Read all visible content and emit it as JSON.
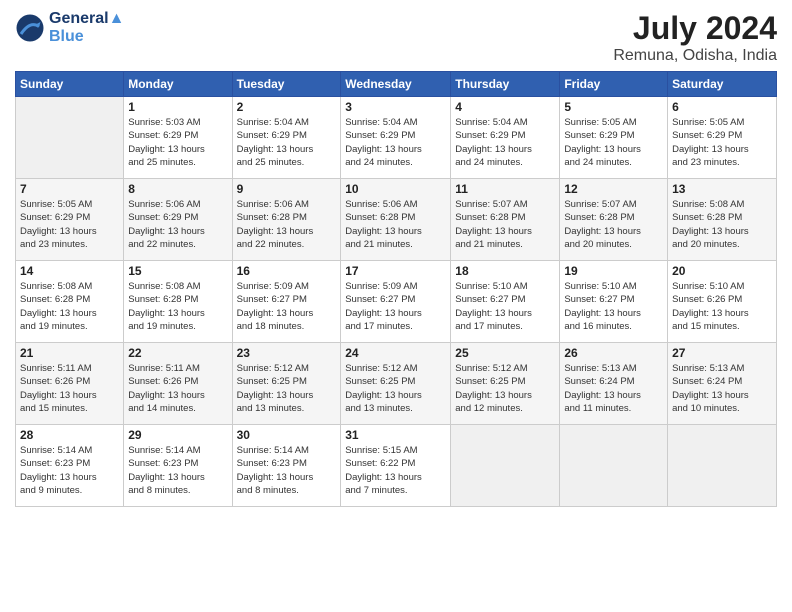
{
  "header": {
    "logo_line1": "General",
    "logo_line2": "Blue",
    "title": "July 2024",
    "location": "Remuna, Odisha, India"
  },
  "weekdays": [
    "Sunday",
    "Monday",
    "Tuesday",
    "Wednesday",
    "Thursday",
    "Friday",
    "Saturday"
  ],
  "weeks": [
    [
      {
        "day": "",
        "info": ""
      },
      {
        "day": "1",
        "info": "Sunrise: 5:03 AM\nSunset: 6:29 PM\nDaylight: 13 hours\nand 25 minutes."
      },
      {
        "day": "2",
        "info": "Sunrise: 5:04 AM\nSunset: 6:29 PM\nDaylight: 13 hours\nand 25 minutes."
      },
      {
        "day": "3",
        "info": "Sunrise: 5:04 AM\nSunset: 6:29 PM\nDaylight: 13 hours\nand 24 minutes."
      },
      {
        "day": "4",
        "info": "Sunrise: 5:04 AM\nSunset: 6:29 PM\nDaylight: 13 hours\nand 24 minutes."
      },
      {
        "day": "5",
        "info": "Sunrise: 5:05 AM\nSunset: 6:29 PM\nDaylight: 13 hours\nand 24 minutes."
      },
      {
        "day": "6",
        "info": "Sunrise: 5:05 AM\nSunset: 6:29 PM\nDaylight: 13 hours\nand 23 minutes."
      }
    ],
    [
      {
        "day": "7",
        "info": "Sunrise: 5:05 AM\nSunset: 6:29 PM\nDaylight: 13 hours\nand 23 minutes."
      },
      {
        "day": "8",
        "info": "Sunrise: 5:06 AM\nSunset: 6:29 PM\nDaylight: 13 hours\nand 22 minutes."
      },
      {
        "day": "9",
        "info": "Sunrise: 5:06 AM\nSunset: 6:28 PM\nDaylight: 13 hours\nand 22 minutes."
      },
      {
        "day": "10",
        "info": "Sunrise: 5:06 AM\nSunset: 6:28 PM\nDaylight: 13 hours\nand 21 minutes."
      },
      {
        "day": "11",
        "info": "Sunrise: 5:07 AM\nSunset: 6:28 PM\nDaylight: 13 hours\nand 21 minutes."
      },
      {
        "day": "12",
        "info": "Sunrise: 5:07 AM\nSunset: 6:28 PM\nDaylight: 13 hours\nand 20 minutes."
      },
      {
        "day": "13",
        "info": "Sunrise: 5:08 AM\nSunset: 6:28 PM\nDaylight: 13 hours\nand 20 minutes."
      }
    ],
    [
      {
        "day": "14",
        "info": "Sunrise: 5:08 AM\nSunset: 6:28 PM\nDaylight: 13 hours\nand 19 minutes."
      },
      {
        "day": "15",
        "info": "Sunrise: 5:08 AM\nSunset: 6:28 PM\nDaylight: 13 hours\nand 19 minutes."
      },
      {
        "day": "16",
        "info": "Sunrise: 5:09 AM\nSunset: 6:27 PM\nDaylight: 13 hours\nand 18 minutes."
      },
      {
        "day": "17",
        "info": "Sunrise: 5:09 AM\nSunset: 6:27 PM\nDaylight: 13 hours\nand 17 minutes."
      },
      {
        "day": "18",
        "info": "Sunrise: 5:10 AM\nSunset: 6:27 PM\nDaylight: 13 hours\nand 17 minutes."
      },
      {
        "day": "19",
        "info": "Sunrise: 5:10 AM\nSunset: 6:27 PM\nDaylight: 13 hours\nand 16 minutes."
      },
      {
        "day": "20",
        "info": "Sunrise: 5:10 AM\nSunset: 6:26 PM\nDaylight: 13 hours\nand 15 minutes."
      }
    ],
    [
      {
        "day": "21",
        "info": "Sunrise: 5:11 AM\nSunset: 6:26 PM\nDaylight: 13 hours\nand 15 minutes."
      },
      {
        "day": "22",
        "info": "Sunrise: 5:11 AM\nSunset: 6:26 PM\nDaylight: 13 hours\nand 14 minutes."
      },
      {
        "day": "23",
        "info": "Sunrise: 5:12 AM\nSunset: 6:25 PM\nDaylight: 13 hours\nand 13 minutes."
      },
      {
        "day": "24",
        "info": "Sunrise: 5:12 AM\nSunset: 6:25 PM\nDaylight: 13 hours\nand 13 minutes."
      },
      {
        "day": "25",
        "info": "Sunrise: 5:12 AM\nSunset: 6:25 PM\nDaylight: 13 hours\nand 12 minutes."
      },
      {
        "day": "26",
        "info": "Sunrise: 5:13 AM\nSunset: 6:24 PM\nDaylight: 13 hours\nand 11 minutes."
      },
      {
        "day": "27",
        "info": "Sunrise: 5:13 AM\nSunset: 6:24 PM\nDaylight: 13 hours\nand 10 minutes."
      }
    ],
    [
      {
        "day": "28",
        "info": "Sunrise: 5:14 AM\nSunset: 6:23 PM\nDaylight: 13 hours\nand 9 minutes."
      },
      {
        "day": "29",
        "info": "Sunrise: 5:14 AM\nSunset: 6:23 PM\nDaylight: 13 hours\nand 8 minutes."
      },
      {
        "day": "30",
        "info": "Sunrise: 5:14 AM\nSunset: 6:23 PM\nDaylight: 13 hours\nand 8 minutes."
      },
      {
        "day": "31",
        "info": "Sunrise: 5:15 AM\nSunset: 6:22 PM\nDaylight: 13 hours\nand 7 minutes."
      },
      {
        "day": "",
        "info": ""
      },
      {
        "day": "",
        "info": ""
      },
      {
        "day": "",
        "info": ""
      }
    ]
  ]
}
